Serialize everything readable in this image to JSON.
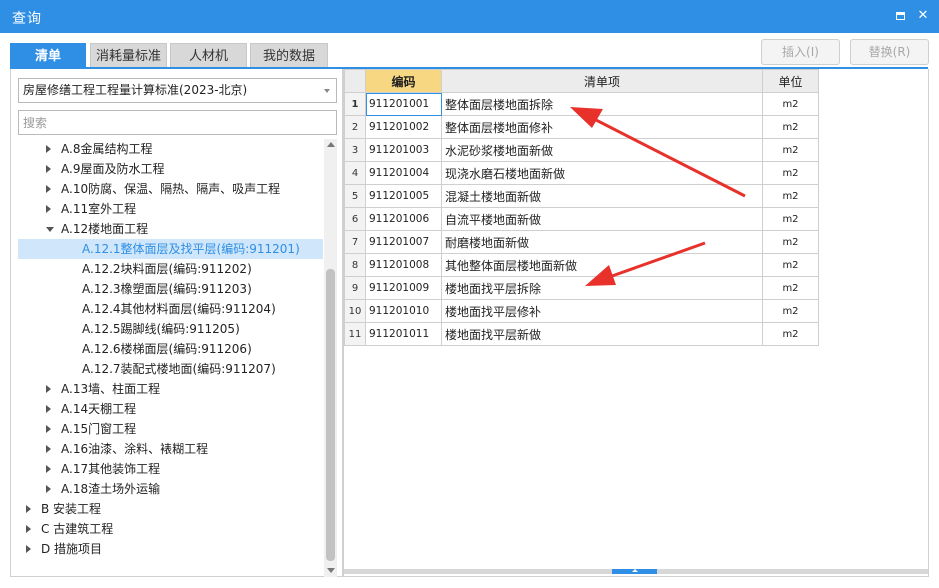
{
  "window": {
    "title": "查询",
    "maximize_icon": "maximize-icon",
    "close_glyph": "✕"
  },
  "tabs": [
    {
      "label": "清单",
      "active": true
    },
    {
      "label": "消耗量标准",
      "active": false
    },
    {
      "label": "人材机",
      "active": false
    },
    {
      "label": "我的数据",
      "active": false
    }
  ],
  "toolbar": {
    "insert_label": "插入(I)",
    "replace_label": "替换(R)"
  },
  "left": {
    "standard_selected": "房屋修缮工程工程量计算标准(2023-北京)",
    "search_placeholder": "搜索",
    "tree": [
      {
        "label": "A.8金属结构工程",
        "expander": "collapsed",
        "level": 1,
        "selected": false
      },
      {
        "label": "A.9屋面及防水工程",
        "expander": "collapsed",
        "level": 1,
        "selected": false
      },
      {
        "label": "A.10防腐、保温、隔热、隔声、吸声工程",
        "expander": "collapsed",
        "level": 1,
        "selected": false
      },
      {
        "label": "A.11室外工程",
        "expander": "collapsed",
        "level": 1,
        "selected": false
      },
      {
        "label": "A.12楼地面工程",
        "expander": "expanded",
        "level": 1,
        "selected": false
      },
      {
        "label": "A.12.1整体面层及找平层(编码:911201)",
        "expander": "none",
        "level": 2,
        "selected": true
      },
      {
        "label": "A.12.2块料面层(编码:911202)",
        "expander": "none",
        "level": 2,
        "selected": false
      },
      {
        "label": "A.12.3橡塑面层(编码:911203)",
        "expander": "none",
        "level": 2,
        "selected": false
      },
      {
        "label": "A.12.4其他材料面层(编码:911204)",
        "expander": "none",
        "level": 2,
        "selected": false
      },
      {
        "label": "A.12.5踢脚线(编码:911205)",
        "expander": "none",
        "level": 2,
        "selected": false
      },
      {
        "label": "A.12.6楼梯面层(编码:911206)",
        "expander": "none",
        "level": 2,
        "selected": false
      },
      {
        "label": "A.12.7装配式楼地面(编码:911207)",
        "expander": "none",
        "level": 2,
        "selected": false
      },
      {
        "label": "A.13墙、柱面工程",
        "expander": "collapsed",
        "level": 1,
        "selected": false
      },
      {
        "label": "A.14天棚工程",
        "expander": "collapsed",
        "level": 1,
        "selected": false
      },
      {
        "label": "A.15门窗工程",
        "expander": "collapsed",
        "level": 1,
        "selected": false
      },
      {
        "label": "A.16油漆、涂料、裱糊工程",
        "expander": "collapsed",
        "level": 1,
        "selected": false
      },
      {
        "label": "A.17其他装饰工程",
        "expander": "collapsed",
        "level": 1,
        "selected": false
      },
      {
        "label": "A.18渣土场外运输",
        "expander": "collapsed",
        "level": 1,
        "selected": false
      },
      {
        "label": "B 安装工程",
        "expander": "collapsed",
        "level": 0,
        "selected": false
      },
      {
        "label": "C 古建筑工程",
        "expander": "collapsed",
        "level": 0,
        "selected": false
      },
      {
        "label": "D 措施项目",
        "expander": "collapsed",
        "level": 0,
        "selected": false
      }
    ]
  },
  "grid": {
    "headers": {
      "rownum": "",
      "code": "编码",
      "name": "清单项",
      "unit": "单位"
    },
    "rows": [
      {
        "n": "1",
        "code": "911201001",
        "name": "整体面层楼地面拆除",
        "unit": "m2"
      },
      {
        "n": "2",
        "code": "911201002",
        "name": "整体面层楼地面修补",
        "unit": "m2"
      },
      {
        "n": "3",
        "code": "911201003",
        "name": "水泥砂浆楼地面新做",
        "unit": "m2"
      },
      {
        "n": "4",
        "code": "911201004",
        "name": "现浇水磨石楼地面新做",
        "unit": "m2"
      },
      {
        "n": "5",
        "code": "911201005",
        "name": "混凝土楼地面新做",
        "unit": "m2"
      },
      {
        "n": "6",
        "code": "911201006",
        "name": "自流平楼地面新做",
        "unit": "m2"
      },
      {
        "n": "7",
        "code": "911201007",
        "name": "耐磨楼地面新做",
        "unit": "m2"
      },
      {
        "n": "8",
        "code": "911201008",
        "name": "其他整体面层楼地面新做",
        "unit": "m2"
      },
      {
        "n": "9",
        "code": "911201009",
        "name": "楼地面找平层拆除",
        "unit": "m2"
      },
      {
        "n": "10",
        "code": "911201010",
        "name": "楼地面找平层修补",
        "unit": "m2"
      },
      {
        "n": "11",
        "code": "911201011",
        "name": "楼地面找平层新做",
        "unit": "m2"
      }
    ]
  },
  "colors": {
    "accent": "#2f8fe5",
    "header_highlight": "#f7d782",
    "annotation_arrow": "#e8312a",
    "selected_row_bg": "#cfe6fb"
  }
}
